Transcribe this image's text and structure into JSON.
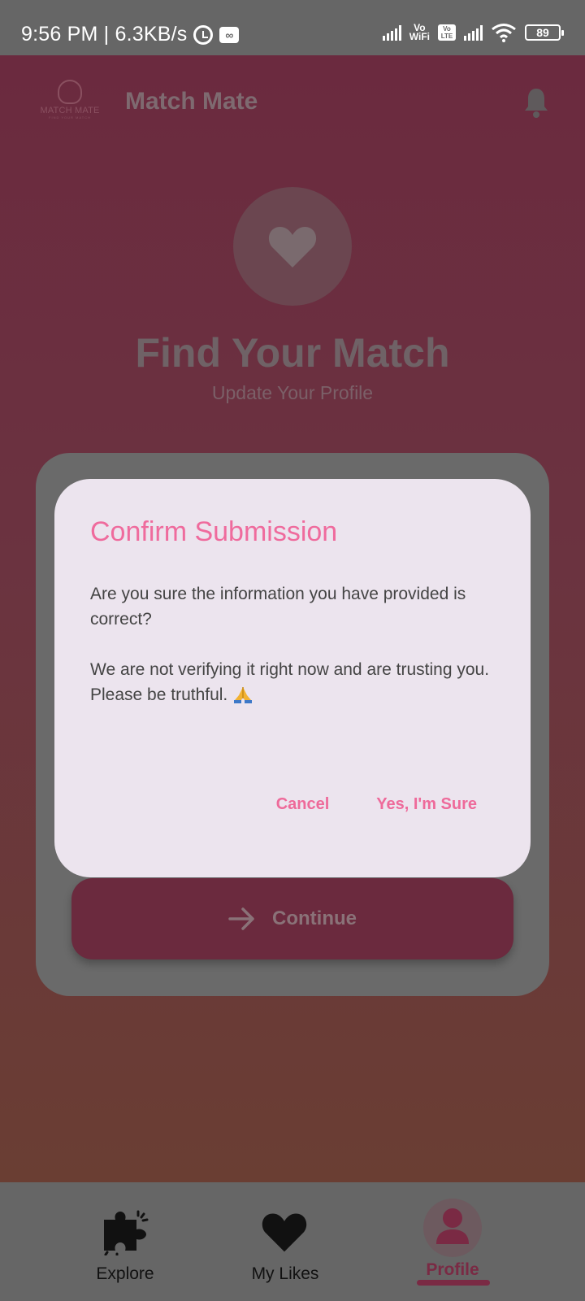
{
  "status_bar": {
    "time_speed": "9:56 PM | 6.3KB/s",
    "vo_wifi_line1": "Vo",
    "vo_wifi_line2": "WiFi",
    "lte_line1": "Vo",
    "lte_line2": "LTE",
    "battery": "89"
  },
  "header": {
    "logo_text": "MATCH MATE",
    "logo_subtext": "FIND YOUR MATCH",
    "title": "Match Mate"
  },
  "hero": {
    "title": "Find Your Match",
    "subtitle": "Update Your Profile"
  },
  "card": {
    "continue_label": "Continue"
  },
  "dialog": {
    "title": "Confirm Submission",
    "body": "Are you sure the information you have provided is correct?\n\n We are not verifying it right now and are trusting you.\n Please be truthful.",
    "cancel_label": "Cancel",
    "confirm_label": "Yes, I'm Sure"
  },
  "bottom_nav": {
    "items": [
      {
        "label": "Explore",
        "icon": "puzzle-icon"
      },
      {
        "label": "My Likes",
        "icon": "heart-icon"
      },
      {
        "label": "Profile",
        "icon": "person-icon"
      }
    ],
    "active": "Profile"
  },
  "colors": {
    "accent_pink": "#ee6a9a",
    "brand_maroon": "#6b2a3e",
    "scrim_gray": "#666666"
  }
}
